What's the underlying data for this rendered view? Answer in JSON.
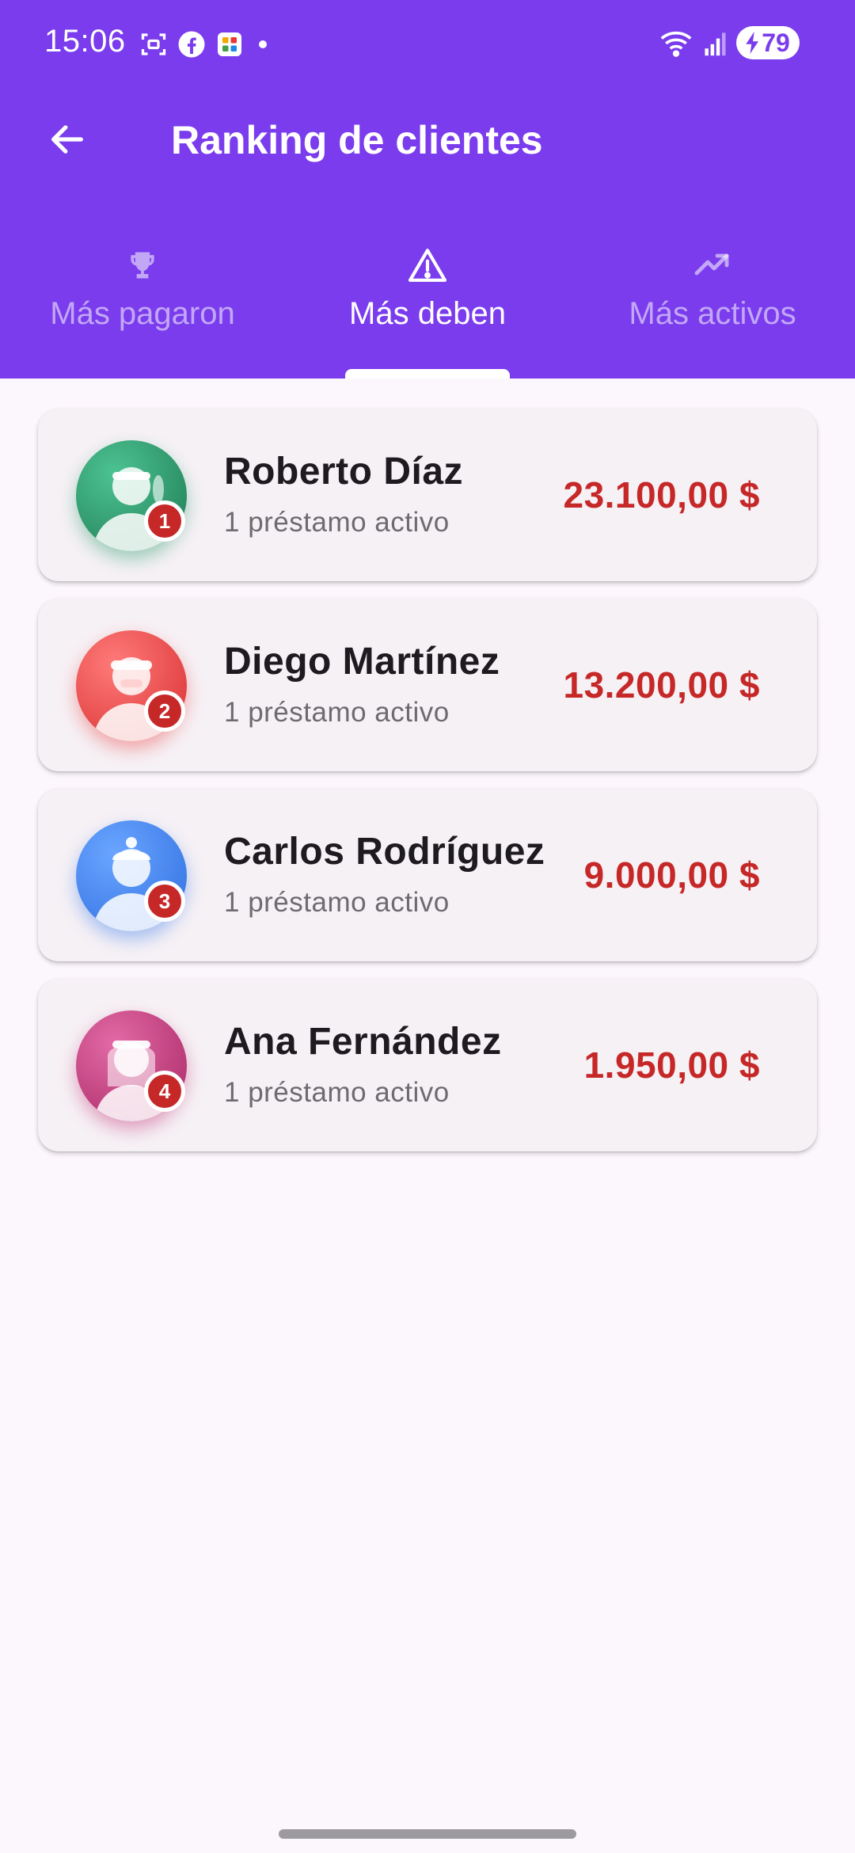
{
  "status_bar": {
    "time": "15:06",
    "battery": "79"
  },
  "app_bar": {
    "title": "Ranking de clientes"
  },
  "tabs": [
    {
      "label": "Más pagaron",
      "icon": "trophy-icon",
      "active": false
    },
    {
      "label": "Más deben",
      "icon": "warning-icon",
      "active": true
    },
    {
      "label": "Más activos",
      "icon": "trending-up-icon",
      "active": false
    }
  ],
  "clients": [
    {
      "rank": "1",
      "name": "Roberto Díaz",
      "subtitle": "1 préstamo activo",
      "amount": "23.100,00 $",
      "color": "#2f9e6e"
    },
    {
      "rank": "2",
      "name": "Diego Martínez",
      "subtitle": "1 préstamo activo",
      "amount": "13.200,00 $",
      "color": "#e84a4a"
    },
    {
      "rank": "3",
      "name": "Carlos Rodríguez",
      "subtitle": "1 préstamo activo",
      "amount": "9.000,00 $",
      "color": "#3f7fea"
    },
    {
      "rank": "4",
      "name": "Ana Fernández",
      "subtitle": "1 préstamo activo",
      "amount": "1.950,00 $",
      "color": "#c23a7a"
    }
  ],
  "colors": {
    "primary": "#7a3ced",
    "amount": "#c62828",
    "background": "#fcf7fd"
  }
}
